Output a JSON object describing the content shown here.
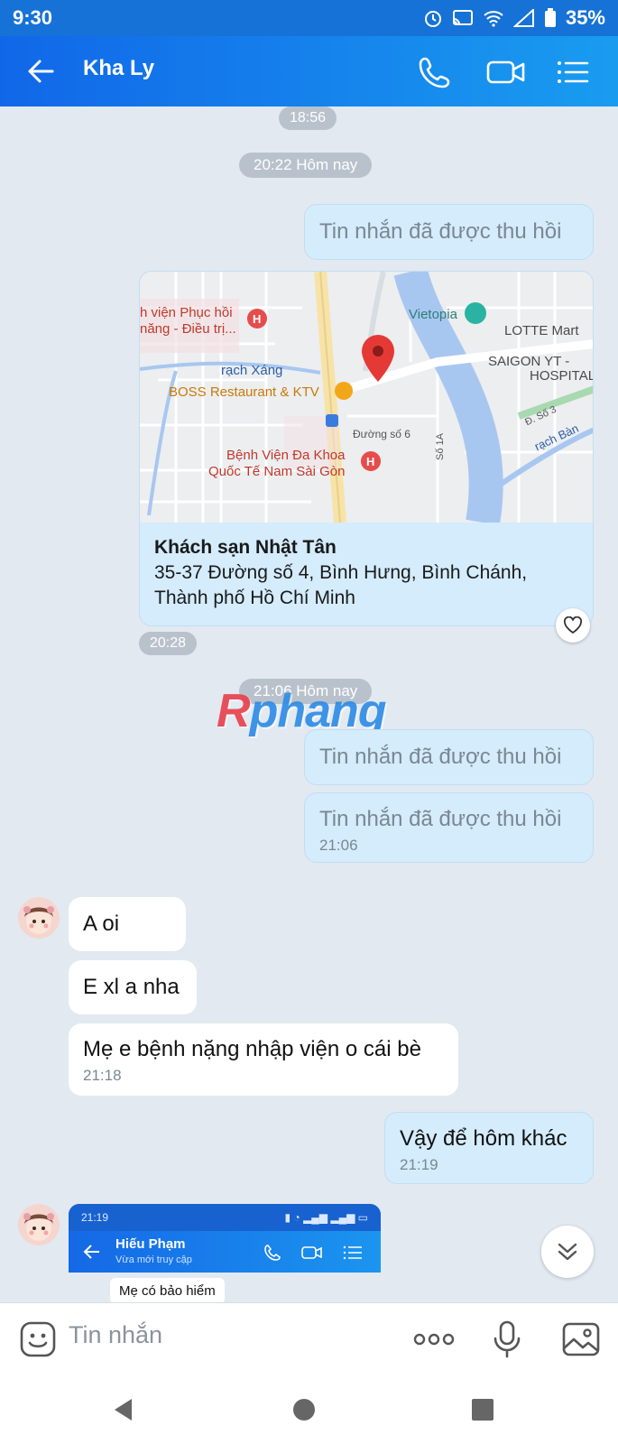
{
  "status_bar": {
    "time": "9:30",
    "battery": "35%"
  },
  "header": {
    "contact_name": "Kha Ly"
  },
  "chat": {
    "top_time": "18:56",
    "divider_1": "20:22 Hôm nay",
    "recalled_1": "Tin nhắn đã được thu hồi",
    "map": {
      "labels": {
        "l1": "h viện Phục hồi",
        "l2": "năng - Điều trị...",
        "l3": "rạch Xáng",
        "l4": "BOSS Restaurant & KTV",
        "l5": "Vietopia",
        "l6": "LOTTE Mart",
        "l7": "SAIGON YT -",
        "l8": "HOSPITAL",
        "l9": "Đường số 6",
        "l10": "Bệnh Viện Đa Khoa",
        "l11": "Quốc Tế Nam Sài Gòn",
        "l12": "Số 1A",
        "l13": "Đ. Số 3",
        "l14": "rạch Bàn"
      },
      "place_name": "Khách sạn Nhật Tân",
      "address_line1": "35-37 Đường số 4, Bình Hưng, Bình Chánh,",
      "address_line2": "Thành phố Hồ Chí Minh"
    },
    "map_time": "20:28",
    "divider_2": "21:06 Hôm nay",
    "watermark": "Rphang",
    "recalled_2": "Tin nhắn đã được thu hồi",
    "recalled_3": "Tin nhắn đã được thu hồi",
    "recalled_3_time": "21:06",
    "msg_1": "A oi",
    "msg_2": "E xl a nha",
    "msg_3": "Mẹ e bệnh nặng nhập viện o cái bè",
    "msg_3_time": "21:18",
    "reply_1": "Vậy để hôm khác",
    "reply_1_time": "21:19",
    "shot": {
      "time": "21:19",
      "name": "Hiếu Phạm",
      "sub": "Vừa mới truy cập",
      "bubble": "Mẹ có bảo hiểm"
    }
  },
  "composer": {
    "placeholder": "Tin nhắn"
  },
  "icons": {
    "back": "back-arrow-icon",
    "phone": "phone-icon",
    "video": "video-icon",
    "menu": "menu-list-icon",
    "emoji": "emoji-icon",
    "more": "more-dots-icon",
    "mic": "mic-icon",
    "image": "image-icon",
    "heart": "heart-icon",
    "scroll": "chevron-double-down-icon"
  },
  "colors": {
    "header_start": "#1167e8",
    "header_end": "#199cf0",
    "my_bubble": "#d4ecfc",
    "chat_bg": "#e2e9f1"
  }
}
